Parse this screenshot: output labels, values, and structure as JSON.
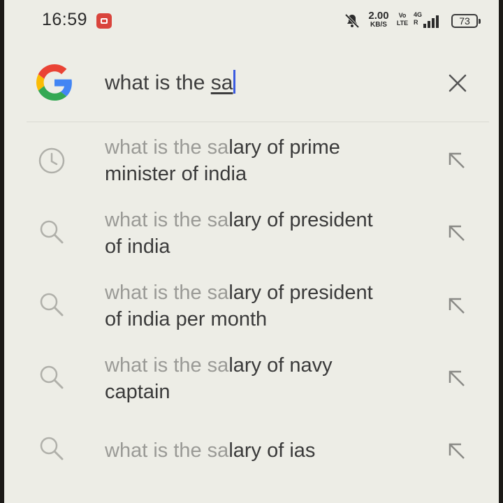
{
  "status_bar": {
    "time": "16:59",
    "speed_value": "2.00",
    "speed_unit": "KB/S",
    "volte_top": "Vo",
    "volte_bottom": "LTE",
    "network_top": "4G",
    "network_bottom": "R",
    "battery": "73",
    "icons": [
      "app-notification-icon",
      "mute-icon",
      "signal-icon",
      "battery-icon"
    ]
  },
  "search": {
    "query_prefix": "what is the ",
    "query_typed": "sa",
    "logo": "google-logo",
    "clear_icon": "close-icon"
  },
  "suggestions": [
    {
      "prefix": "what is the sa",
      "line1_rest": "lary of prime",
      "line2": "minister of india",
      "icon": "history-icon"
    },
    {
      "prefix": "what is the sa",
      "line1_rest": "lary of president",
      "line2": "of india",
      "icon": "search-icon"
    },
    {
      "prefix": "what is the sa",
      "line1_rest": "lary of president",
      "line2": "of india per month",
      "icon": "search-icon"
    },
    {
      "prefix": "what is the sa",
      "line1_rest": "lary of navy",
      "line2": "captain",
      "icon": "search-icon"
    },
    {
      "prefix": "what is the sa",
      "line1_rest": "lary of ias",
      "line2": "",
      "icon": "search-icon"
    }
  ],
  "colors": {
    "background": "#edede6",
    "caret": "#3b5be0",
    "muted_text": "#9a9a96",
    "text": "#3a3a3a"
  }
}
